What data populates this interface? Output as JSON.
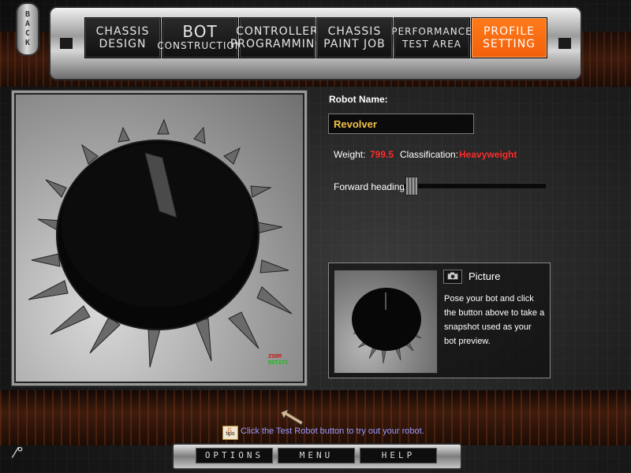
{
  "nav": {
    "back_label": "BACK",
    "tabs": [
      {
        "line1": "CHASSIS",
        "line2": "DESIGN"
      },
      {
        "line1": "BOT",
        "line2": "CONSTRUCTION"
      },
      {
        "line1": "CONTROLLER",
        "line2": "PROGRAMMING"
      },
      {
        "line1": "CHASSIS",
        "line2": "PAINT JOB"
      },
      {
        "line1": "PERFORMANCE",
        "line2": "TEST AREA"
      },
      {
        "line1": "PROFILE",
        "line2": "SETTING"
      }
    ],
    "active_tab": "PROFILE SETTING"
  },
  "viewer": {
    "zoom_label": "ZOOM",
    "rotate_label": "ROTATE"
  },
  "profile": {
    "robot_name_label": "Robot Name:",
    "robot_name_value": "Revolver",
    "weight_label": "Weight:",
    "weight_value": "799.5",
    "classification_label": "Classification:",
    "classification_value": "Heavyweight",
    "heading_label": "Forward heading:",
    "heading_value": 0.0
  },
  "picture": {
    "title": "Picture",
    "description": "Pose your bot and click the button above to take a snapshot used as your bot preview."
  },
  "tip": {
    "icon_label": "tips",
    "text": "Click the Test Robot button to try out your robot."
  },
  "bottom": {
    "options_label": "OPTIONS",
    "menu_label": "MENU",
    "help_label": "HELP"
  },
  "colors": {
    "accent_active_tab": "#f2600a",
    "name_value": "#f0c247",
    "stat_value": "#ff2a2a",
    "tip_text": "#9a98ff"
  }
}
